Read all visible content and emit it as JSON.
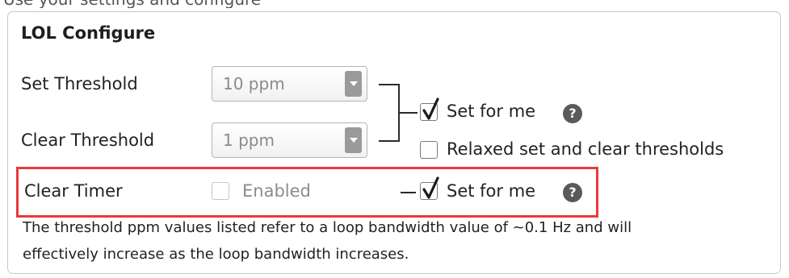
{
  "header_fragment": "Use your settings and configure",
  "panel": {
    "title": "LOL Configure"
  },
  "rows": {
    "set_threshold": {
      "label": "Set Threshold",
      "value": "10 ppm"
    },
    "clear_threshold": {
      "label": "Clear Threshold",
      "value": "1 ppm"
    },
    "clear_timer": {
      "label": "Clear Timer",
      "checkbox_label": "Enabled",
      "checked": false,
      "disabled": true
    }
  },
  "threshold_options": {
    "set_for_me": {
      "label": "Set for me",
      "checked": true
    },
    "relaxed": {
      "label": "Relaxed set and clear thresholds",
      "checked": false
    }
  },
  "timer_options": {
    "set_for_me": {
      "label": "Set for me",
      "checked": true
    }
  },
  "help_glyph": "?",
  "note": {
    "line1": "The threshold ppm values listed refer to a loop bandwidth value of ~0.1 Hz and will",
    "line2": "effectively increase as the loop bandwidth increases."
  },
  "colors": {
    "highlight": "#e8393c",
    "help_badge": "#5a5a5a",
    "dropdown_arrow": "#9a9a9a"
  },
  "icons": {
    "dropdown": "chevron-down-icon",
    "help": "help-icon",
    "check": "checkmark-icon"
  }
}
